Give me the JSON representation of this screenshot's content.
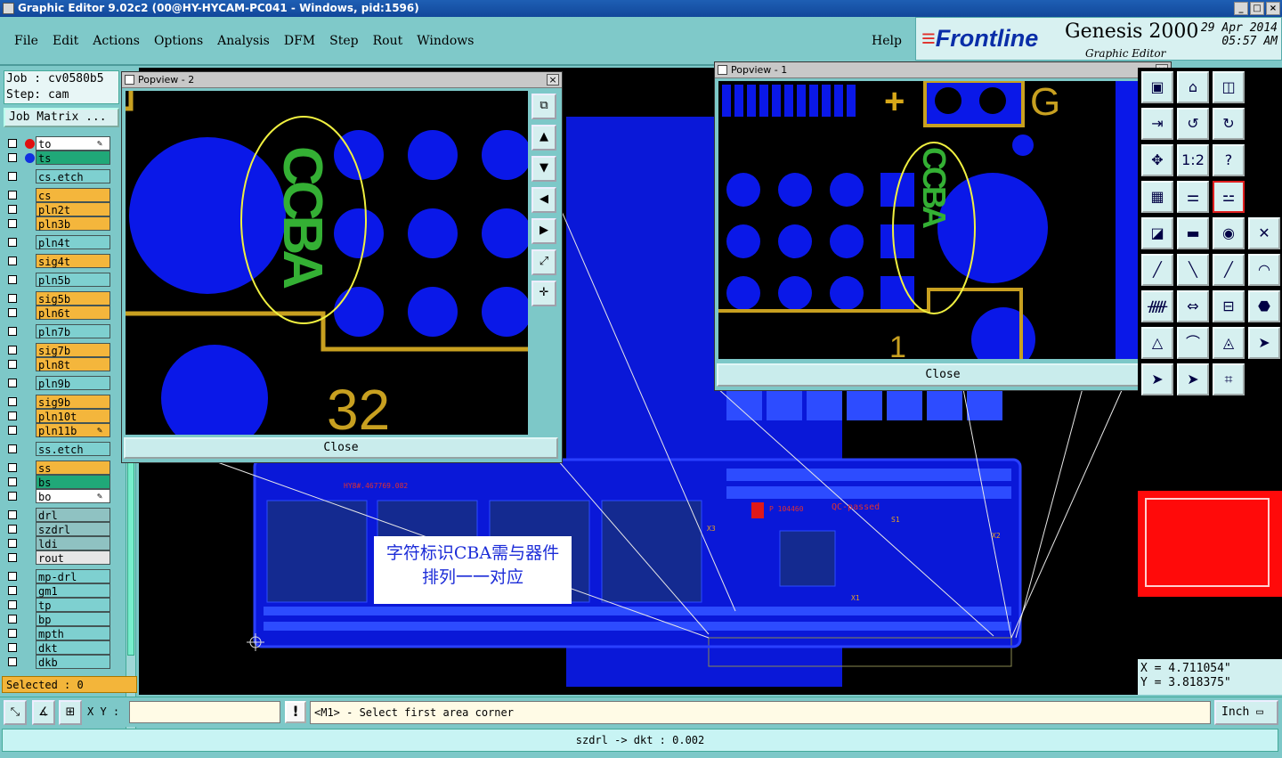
{
  "window": {
    "title": "Graphic Editor 9.02c2 (00@HY-HYCAM-PC041 - Windows, pid:1596)",
    "btn_min": "_",
    "btn_max": "□",
    "btn_close": "×"
  },
  "menu": [
    "File",
    "Edit",
    "Actions",
    "Options",
    "Analysis",
    "DFM",
    "Step",
    "Rout",
    "Windows"
  ],
  "help": "Help",
  "brand": {
    "logo": "Frontline",
    "product": "Genesis 2000",
    "subtitle": "Graphic Editor",
    "date": "29 Apr 2014",
    "time": "05:57 AM"
  },
  "job": {
    "job_line": "Job : cv0580b5",
    "step_line": "Step: cam",
    "matrix_btn": "Job Matrix ..."
  },
  "layers": [
    {
      "name": "to",
      "color": "#ffffff",
      "dot": "#e01010",
      "pen": true
    },
    {
      "name": "ts",
      "color": "#20a878",
      "dot": "#1030e0"
    },
    {
      "name": "cs.etch",
      "color": "#7ed0d0"
    },
    {
      "name": "cs",
      "color": "#f4b63c"
    },
    {
      "name": "pln2t",
      "color": "#f4b63c"
    },
    {
      "name": "pln3b",
      "color": "#f4b63c"
    },
    {
      "name": "pln4t",
      "color": "#7ed0d0"
    },
    {
      "name": "sig4t",
      "color": "#f4b63c"
    },
    {
      "name": "pln5b",
      "color": "#7ed0d0"
    },
    {
      "name": "sig5b",
      "color": "#f4b63c"
    },
    {
      "name": "pln6t",
      "color": "#f4b63c"
    },
    {
      "name": "pln7b",
      "color": "#7ed0d0"
    },
    {
      "name": "sig7b",
      "color": "#f4b63c"
    },
    {
      "name": "pln8t",
      "color": "#f4b63c"
    },
    {
      "name": "pln9b",
      "color": "#7ed0d0"
    },
    {
      "name": "sig9b",
      "color": "#f4b63c"
    },
    {
      "name": "pln10t",
      "color": "#f4b63c"
    },
    {
      "name": "pln11b",
      "color": "#f4b63c",
      "pen": true
    },
    {
      "name": "ss.etch",
      "color": "#7ed0d0"
    },
    {
      "name": "ss",
      "color": "#f4b63c"
    },
    {
      "name": "bs",
      "color": "#20a878"
    },
    {
      "name": "bo",
      "color": "#ffffff",
      "pen": true
    },
    {
      "name": "drl",
      "color": "#8fc2c2"
    },
    {
      "name": "szdrl",
      "color": "#8fc2c2"
    },
    {
      "name": "ldi",
      "color": "#8fc2c2"
    },
    {
      "name": "rout",
      "color": "#e6e6e6"
    },
    {
      "name": "mp-drl",
      "color": "#7ed0d0"
    },
    {
      "name": "gm1",
      "color": "#7ed0d0"
    },
    {
      "name": "tp",
      "color": "#7ed0d0"
    },
    {
      "name": "bp",
      "color": "#7ed0d0"
    },
    {
      "name": "mpth",
      "color": "#7ed0d0"
    },
    {
      "name": "dkt",
      "color": "#7ed0d0"
    },
    {
      "name": "dkb",
      "color": "#7ed0d0"
    }
  ],
  "selected": "Selected : 0",
  "popview2": {
    "title": "Popview - 2",
    "close": "Close",
    "silk_text": "CCBA",
    "pad_label": "32"
  },
  "popview1": {
    "title": "Popview - 1",
    "close": "Close",
    "label_g": "G",
    "label_plus": "+",
    "label_1": "1",
    "silk_text": "CCBA"
  },
  "board_labels": {
    "part_no": "HY8#.467769.082",
    "qc": "QC-passed",
    "s1": "S1",
    "x1": "X1",
    "x2": "X2",
    "x3": "X3",
    "part_bottom": "P 104460"
  },
  "annotation": {
    "line1": "字符标识CBA需与器件",
    "line2": "排列一一对应"
  },
  "coords": {
    "x": "X = 4.711054\"",
    "y": "Y = 3.818375\""
  },
  "bottom": {
    "xy_label": "X Y :",
    "xy_value": "",
    "prompt": "<M1> - Select first area corner",
    "unit": "Inch",
    "status": "szdrl -> dkt : 0.002",
    "excl": "!"
  },
  "tools": [
    "save-view-icon",
    "home-icon",
    "window-split-icon",
    "redo-view-icon",
    "zoom-back-icon",
    "swap-icon",
    "pan-icon",
    "one-to-one-icon",
    "help-icon",
    "grid-icon",
    "layer-color-icon",
    "layer-color2-icon",
    "snap-icon",
    "ruler-icon",
    "circle-select-icon",
    "cross-icon",
    "line-icon",
    "line2-icon",
    "draw-line-icon",
    "arc-icon",
    "text-icon",
    "measure-icon",
    "dim-icon",
    "group-icon",
    "triangle-icon",
    "arch-icon",
    "arch2-icon",
    "pointer-icon",
    "pointer2-icon",
    "pointer3-icon",
    "node-icon"
  ]
}
